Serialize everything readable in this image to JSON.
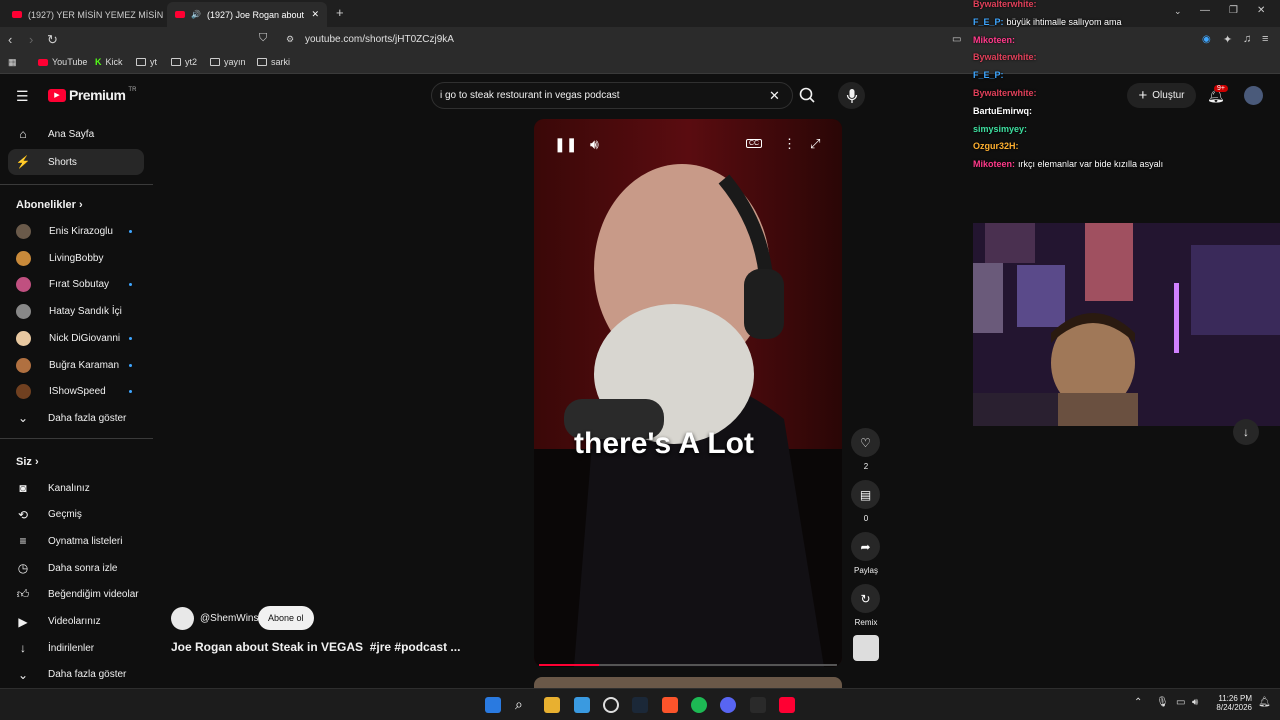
{
  "browser": {
    "tabs": [
      {
        "title": "(1927) YER MİSİN YEMEZ MİSİN SERİ"
      },
      {
        "title": "(1927) Joe Rogan about Steak"
      }
    ],
    "url": "youtube.com/shorts/jHT0ZCzj9kA",
    "bookmarks": [
      "YouTube",
      "Kick",
      "yt",
      "yt2",
      "yayın",
      "sarki"
    ]
  },
  "youtube": {
    "logo": "Premium",
    "logo_sup": "TR",
    "search_value": "i go to steak restourant in vegas podcast",
    "create_label": "Oluştur",
    "notif_badge": "9+",
    "sidebar": {
      "main": [
        {
          "label": "Ana Sayfa",
          "icon": "home-icon"
        },
        {
          "label": "Shorts",
          "icon": "shorts-icon"
        }
      ],
      "subs_header": "Abonelikler",
      "subs": [
        {
          "label": "Enis Kirazoglu",
          "dot": true,
          "color": "#6a5a4a"
        },
        {
          "label": "LivingBobby",
          "dot": false,
          "color": "#c98a3a"
        },
        {
          "label": "Fırat Sobutay",
          "dot": true,
          "color": "#c05080"
        },
        {
          "label": "Hatay Sandık İçi",
          "dot": false,
          "color": "#888888"
        },
        {
          "label": "Nick DiGiovanni",
          "dot": true,
          "color": "#e8c8a0"
        },
        {
          "label": "Buğra Karaman",
          "dot": true,
          "color": "#b07040"
        },
        {
          "label": "IShowSpeed",
          "dot": true,
          "color": "#704020"
        }
      ],
      "subs_more": "Daha fazla göster",
      "you_header": "Siz",
      "you": [
        {
          "label": "Kanalınız",
          "icon": "user-icon"
        },
        {
          "label": "Geçmiş",
          "icon": "history-icon"
        },
        {
          "label": "Oynatma listeleri",
          "icon": "playlist-icon"
        },
        {
          "label": "Daha sonra izle",
          "icon": "clock-icon"
        },
        {
          "label": "Beğendiğim videolar",
          "icon": "like-icon"
        },
        {
          "label": "Videolarınız",
          "icon": "video-icon"
        },
        {
          "label": "İndirilenler",
          "icon": "download-icon"
        },
        {
          "label": "Daha fazla göster",
          "icon": "chevron-down-icon"
        }
      ]
    },
    "short": {
      "caption": "there's A Lot",
      "channel": "@ShemWins",
      "subscribe": "Abone ol",
      "title": "Joe Rogan about Steak in VEGAS  #jre #podcast ...",
      "progress": 0.2
    },
    "rail": {
      "likes": "2",
      "comments": "0",
      "share": "Paylaş",
      "remix": "Remix"
    }
  },
  "chat": [
    {
      "user": "Bywalterwhite:",
      "msg": "",
      "color": "#e0405a"
    },
    {
      "user": "F_E_P:",
      "msg": "büyük ihtimalle sallıyom ama",
      "color": "#3ea6ff"
    },
    {
      "user": "Mikoteen:",
      "msg": "",
      "color": "#ff3a8a"
    },
    {
      "user": "Bywalterwhite:",
      "msg": "",
      "color": "#e0405a"
    },
    {
      "user": "F_E_P:",
      "msg": "",
      "color": "#3ea6ff"
    },
    {
      "user": "Bywalterwhite:",
      "msg": "",
      "color": "#e0405a"
    },
    {
      "user": "BartuEmirwq:",
      "msg": "",
      "color": "#ffffff"
    },
    {
      "user": "simysimyey:",
      "msg": "",
      "color": "#3ee0a0"
    },
    {
      "user": "Ozgur32H:",
      "msg": "",
      "color": "#ffb030"
    },
    {
      "user": "Mikoteen:",
      "msg": "ırkçı elemanlar var bide kızılla asyalı",
      "color": "#ff3a8a"
    }
  ],
  "taskbar": {
    "time": "11:26 PM",
    "date": "8/24/2026"
  }
}
